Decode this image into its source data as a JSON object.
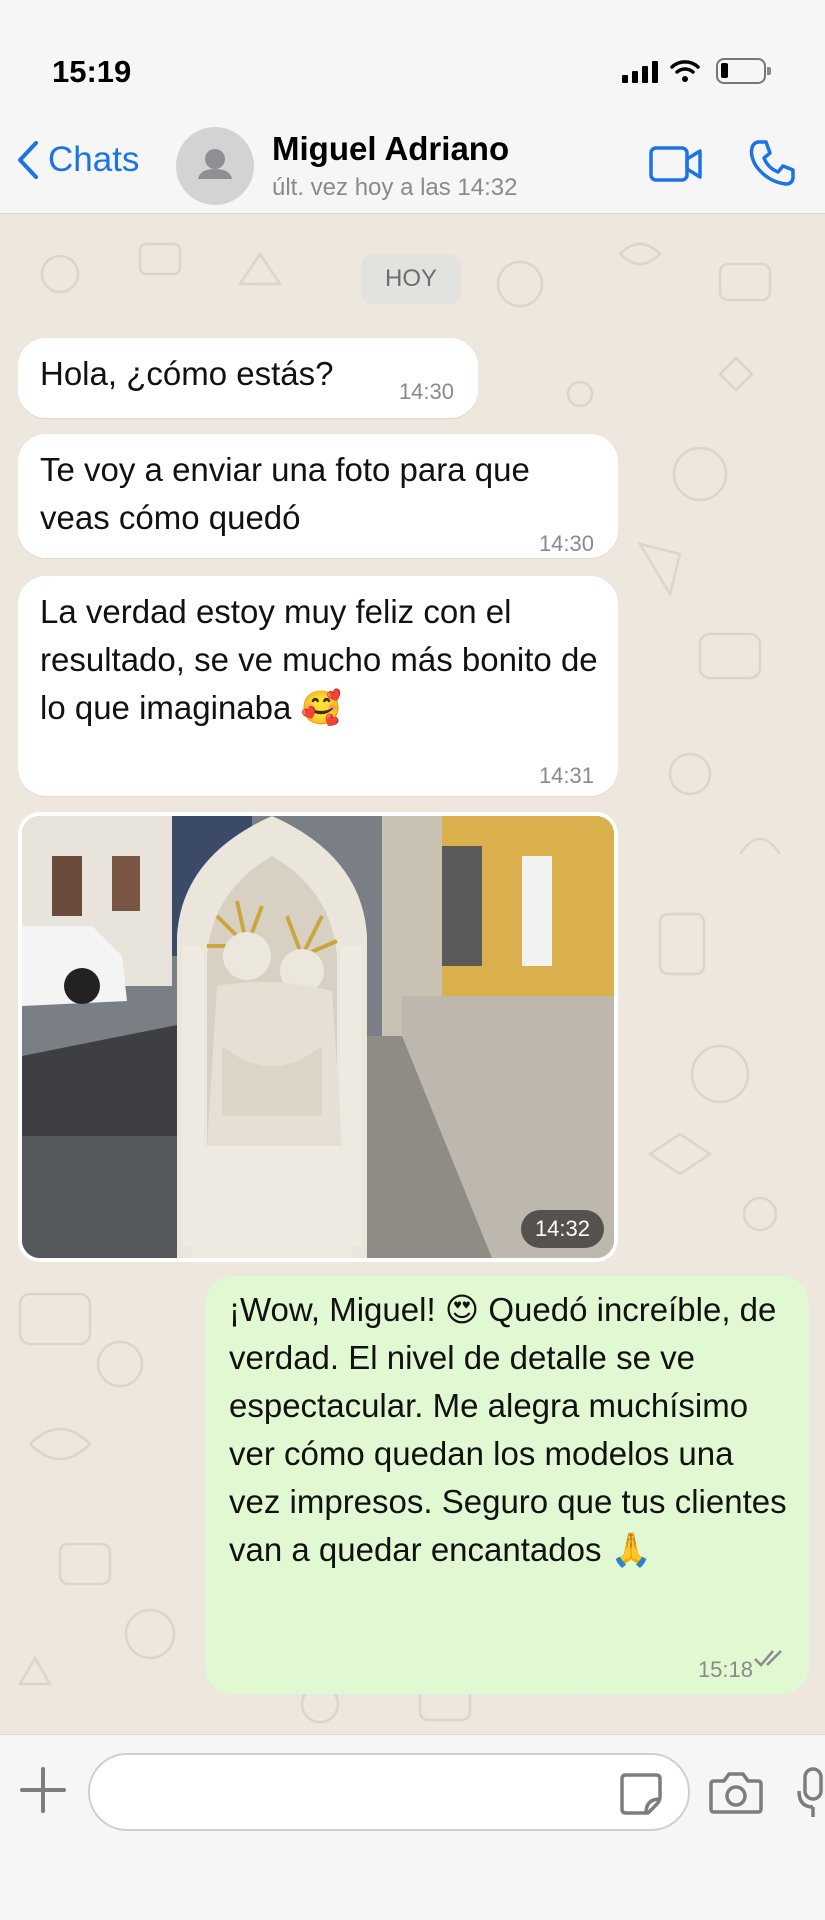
{
  "status_bar": {
    "time": "15:19"
  },
  "header": {
    "back_label": "Chats",
    "contact_name": "Miguel Adriano",
    "contact_status": "últ. vez hoy a las 14:32"
  },
  "chat": {
    "date_chip": "HOY",
    "messages": [
      {
        "direction": "in",
        "text": "Hola, ¿cómo estás?",
        "time": "14:30"
      },
      {
        "direction": "in",
        "text": "Te voy a enviar una foto para que veas cómo quedó",
        "time": "14:30"
      },
      {
        "direction": "in",
        "text": "La verdad estoy muy feliz con el resultado, se ve mucho más bonito de lo que imaginaba 🥰",
        "time": "14:31"
      },
      {
        "direction": "in",
        "type": "photo",
        "time": "14:32"
      },
      {
        "direction": "out",
        "text": "¡Wow, Miguel! 😍 Quedó increíble, de verdad. El nivel de detalle se ve espectacular. Me alegra muchísimo ver cómo quedan los modelos una vez impresos. Seguro que tus clientes van a quedar encantados 🙏",
        "time": "15:18",
        "status": "read"
      }
    ]
  },
  "input": {
    "placeholder": ""
  },
  "colors": {
    "accent": "#1a73e8",
    "outgoing_bubble": "#e1f9d2",
    "incoming_bubble": "#ffffff",
    "chat_background": "#ede7dd"
  },
  "icons": [
    "back-chevron-icon",
    "avatar-placeholder-icon",
    "video-call-icon",
    "phone-icon",
    "plus-icon",
    "sticker-icon",
    "camera-icon",
    "microphone-icon",
    "double-check-icon"
  ]
}
